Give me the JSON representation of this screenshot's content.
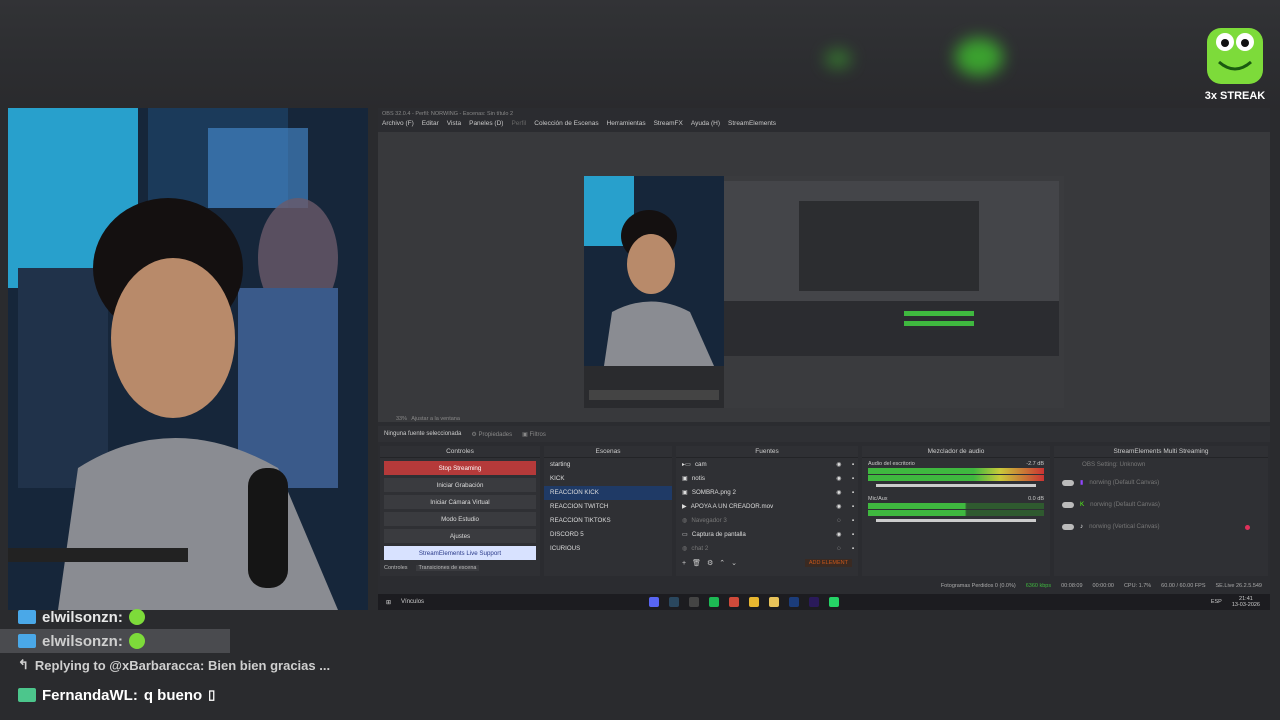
{
  "streak": {
    "label": "3x STREAK"
  },
  "obs": {
    "title": "OBS 32.0.4 - Perfil: NORWING - Escenas: Sin título 2",
    "menu": [
      "Archivo (F)",
      "Editar",
      "Vista",
      "Paneles (D)",
      "Perfil",
      "Colección de Escenas",
      "Herramientas",
      "StreamFX",
      "Ayuda (H)",
      "StreamElements"
    ],
    "zoom": "33%",
    "fit_label": "Ajustar a la ventana",
    "source_bar": {
      "none_selected": "Ninguna fuente seleccionada",
      "properties": "Propiedades",
      "filters": "Filtros"
    },
    "docks": {
      "controls": {
        "title": "Controles",
        "buttons": [
          "Stop Streaming",
          "Iniciar Grabación",
          "Iniciar Cámara Virtual",
          "Modo Estudio",
          "Ajustes",
          "StreamElements Live Support"
        ],
        "tabs": [
          "Controles",
          "Transiciones de escena"
        ]
      },
      "scenes": {
        "title": "Escenas",
        "items": [
          "starting",
          "KICK",
          "REACCION KICK",
          "REACCION TWITCH",
          "REACCION TIKTOKS",
          "DISCORD 5",
          "ICURIOUS"
        ]
      },
      "sources": {
        "title": "Fuentes",
        "items": [
          "cam",
          "notis",
          "SOMBRA.png 2",
          "APOYA A UN CREADOR.mov",
          "Navegador 3",
          "Captura de pantalla",
          "chat 2"
        ],
        "add_element": "ADD ELEMENT"
      },
      "mixer": {
        "title": "Mezclador de audio",
        "channels": [
          {
            "name": "Audio del escritorio",
            "db": "-2.7 dB"
          },
          {
            "name": "Mic/Aux",
            "db": "0.0 dB"
          }
        ]
      },
      "multistream": {
        "title": "StreamElements Multi Streaming",
        "rows": [
          "OBS Setting: Unknown",
          "norwing (Default Canvas)",
          "norwing (Default Canvas)",
          "norwing (Vertical Canvas)"
        ]
      }
    },
    "status": {
      "dropped": "Fotogramas Perdidos 0 (0.0%)",
      "bitrate": "6360 kbps",
      "time": "00:08:09",
      "rec": "00:00:00",
      "cpu": "CPU: 1.7%",
      "fps": "60.00 / 60.00 FPS",
      "version": "SE.Live 26.2.5.549"
    },
    "taskbar": {
      "links": "Vínculos",
      "time": "21:41",
      "date": "13-03-2026",
      "lang": "ESP"
    }
  },
  "chat": [
    {
      "user": "elwilsonzn:",
      "type": "emote"
    },
    {
      "user": "elwilsonzn:",
      "type": "emote-hl"
    },
    {
      "text": "Replying to @xBarbaracca: Bien bien gracias ...",
      "type": "reply"
    },
    {
      "user": "FernandaWL:",
      "message": "q bueno",
      "type": "msg"
    }
  ],
  "colors": {
    "stream_red": "#b53a3a",
    "selected_blue": "#1f3a66",
    "meter_green": "#3fb83f",
    "streak_green": "#7ddb3a",
    "user_blue": "#4aa8e8"
  }
}
